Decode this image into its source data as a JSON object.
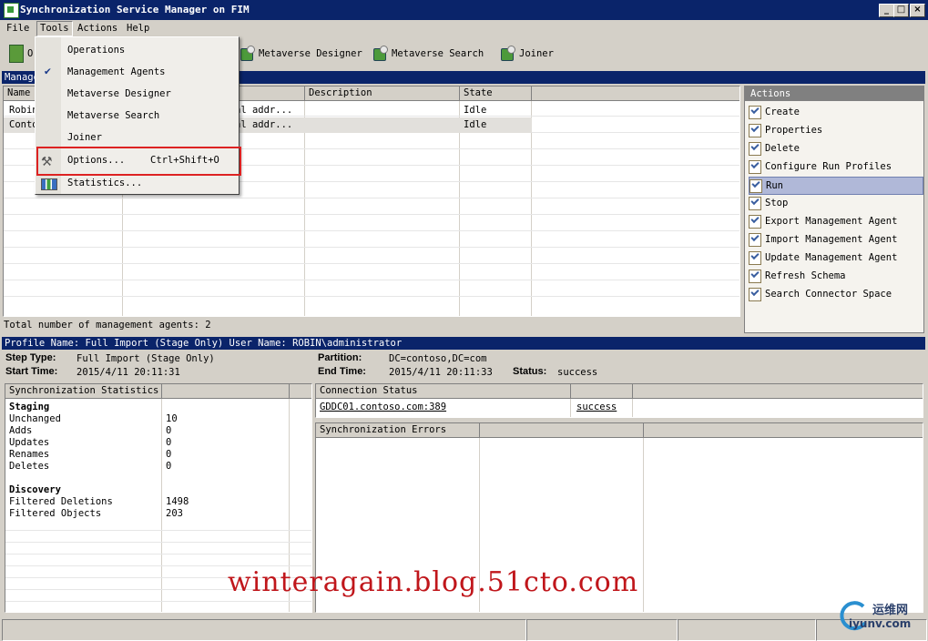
{
  "window": {
    "title": "Synchronization Service Manager on FIM"
  },
  "menubar": {
    "file": "File",
    "tools": "Tools",
    "actions": "Actions",
    "help": "Help"
  },
  "toolbar": {
    "partial_left": "O",
    "metaverse_designer": "Metaverse Designer",
    "metaverse_search": "Metaverse Search",
    "joiner": "Joiner"
  },
  "tools_menu": {
    "items": [
      {
        "label": "Operations",
        "shortcut": ""
      },
      {
        "label": "Management Agents",
        "shortcut": "",
        "checked": true
      },
      {
        "label": "Metaverse Designer",
        "shortcut": ""
      },
      {
        "label": "Metaverse Search",
        "shortcut": ""
      },
      {
        "label": "Joiner",
        "shortcut": ""
      },
      {
        "label": "Options...",
        "shortcut": "Ctrl+Shift+O"
      },
      {
        "label": "Statistics...",
        "shortcut": ""
      }
    ]
  },
  "ma_section": {
    "title_partial": "Manage"
  },
  "ma_grid": {
    "headers": [
      "Name",
      "",
      "Description",
      "State",
      ""
    ],
    "rows": [
      [
        "Robin",
        "al addr...",
        "",
        "Idle"
      ],
      [
        "Conto",
        "al addr...",
        "",
        "Idle"
      ]
    ],
    "total_text": "Total number of management agents: 2"
  },
  "actions_panel": {
    "title": "Actions",
    "items": [
      "Create",
      "Properties",
      "Delete",
      "Configure Run Profiles",
      "Run",
      "Stop",
      "Export Management Agent",
      "Import Management Agent",
      "Update Management Agent",
      "Refresh Schema",
      "Search Connector Space"
    ],
    "selected": "Run"
  },
  "profile_bar": {
    "text": "Profile Name: Full Import (Stage Only)  User Name: ROBIN\\administrator"
  },
  "run_details": {
    "step_type_label": "Step Type:",
    "step_type_value": "Full Import (Stage Only)",
    "start_time_label": "Start Time:",
    "start_time_value": "2015/4/11 20:11:31",
    "partition_label": "Partition:",
    "partition_value": "DC=contoso,DC=com",
    "end_time_label": "End Time:",
    "end_time_value": "2015/4/11 20:11:33",
    "status_label": "Status:",
    "status_value": "success"
  },
  "sync_stats": {
    "header": "Synchronization Statistics",
    "staging_title": "Staging",
    "staging": [
      {
        "label": "Unchanged",
        "value": "10"
      },
      {
        "label": "Adds",
        "value": "0"
      },
      {
        "label": "Updates",
        "value": "0"
      },
      {
        "label": "Renames",
        "value": "0"
      },
      {
        "label": "Deletes",
        "value": "0"
      }
    ],
    "discovery_title": "Discovery",
    "discovery": [
      {
        "label": "Filtered Deletions",
        "value": "1498"
      },
      {
        "label": "Filtered Objects",
        "value": "203"
      }
    ]
  },
  "connection_status": {
    "header": "Connection Status",
    "server": "GDDC01.contoso.com:389",
    "result": "success"
  },
  "sync_errors": {
    "header": "Synchronization Errors"
  },
  "watermark": {
    "text": "winteragain.blog.51cto.com",
    "logo_text": "运维网",
    "logo_sub": "iyunv.com"
  },
  "colors": {
    "title_bar": "#0a246a",
    "highlight_border": "#dd2222",
    "watermark": "#c0161b"
  }
}
